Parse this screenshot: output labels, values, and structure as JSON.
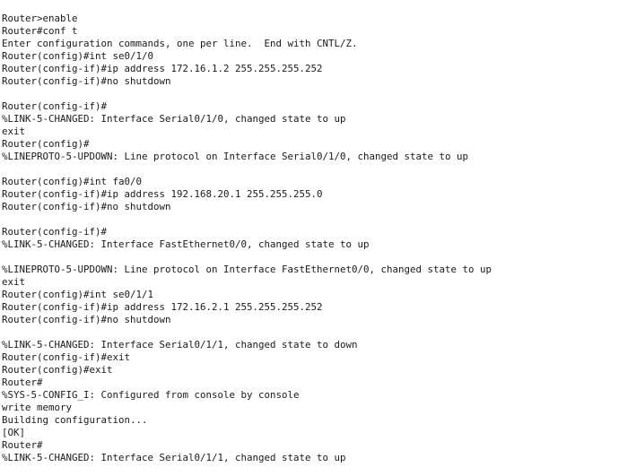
{
  "terminal": {
    "lines": [
      "Router>enable",
      "Router#conf t",
      "Enter configuration commands, one per line.  End with CNTL/Z.",
      "Router(config)#int se0/1/0",
      "Router(config-if)#ip address 172.16.1.2 255.255.255.252",
      "Router(config-if)#no shutdown",
      "",
      "Router(config-if)#",
      "%LINK-5-CHANGED: Interface Serial0/1/0, changed state to up",
      "exit",
      "Router(config)#",
      "%LINEPROTO-5-UPDOWN: Line protocol on Interface Serial0/1/0, changed state to up",
      "",
      "Router(config)#int fa0/0",
      "Router(config-if)#ip address 192.168.20.1 255.255.255.0",
      "Router(config-if)#no shutdown",
      "",
      "Router(config-if)#",
      "%LINK-5-CHANGED: Interface FastEthernet0/0, changed state to up",
      "",
      "%LINEPROTO-5-UPDOWN: Line protocol on Interface FastEthernet0/0, changed state to up",
      "exit",
      "Router(config)#int se0/1/1",
      "Router(config-if)#ip address 172.16.2.1 255.255.255.252",
      "Router(config-if)#no shutdown",
      "",
      "%LINK-5-CHANGED: Interface Serial0/1/1, changed state to down",
      "Router(config-if)#exit",
      "Router(config)#exit",
      "Router#",
      "%SYS-5-CONFIG_I: Configured from console by console",
      "write memory",
      "Building configuration...",
      "[OK]",
      "Router#",
      "%LINK-5-CHANGED: Interface Serial0/1/1, changed state to up"
    ]
  }
}
